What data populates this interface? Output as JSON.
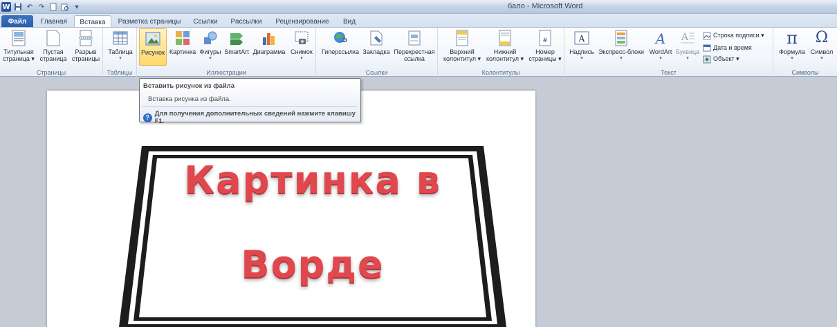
{
  "window": {
    "title": "бало - Microsoft Word"
  },
  "tabs": [
    {
      "label": "Файл"
    },
    {
      "label": "Главная"
    },
    {
      "label": "Вставка"
    },
    {
      "label": "Разметка страницы"
    },
    {
      "label": "Ссылки"
    },
    {
      "label": "Рассылки"
    },
    {
      "label": "Рецензирование"
    },
    {
      "label": "Вид"
    }
  ],
  "ribbon": {
    "groups": {
      "pages": "Страницы",
      "tables": "Таблицы",
      "illustrations": "Иллюстрации",
      "links": "Ссылки",
      "headers": "Колонтитулы",
      "text": "Текст",
      "symbols": "Символы"
    },
    "buttons": {
      "title_page_1": "Титульная",
      "title_page_2": "страница ▾",
      "blank_page_1": "Пустая",
      "blank_page_2": "страница",
      "page_break_1": "Разрыв",
      "page_break_2": "страницы",
      "table": "Таблица",
      "picture": "Рисунок",
      "clipart": "Картинка",
      "shapes": "Фигуры",
      "smartart": "SmartArt",
      "chart": "Диаграмма",
      "screenshot": "Снимок",
      "hyperlink": "Гиперссылка",
      "bookmark": "Закладка",
      "crossref_1": "Перекрестная",
      "crossref_2": "ссылка",
      "header_1": "Верхний",
      "header_2": "колонтитул ▾",
      "footer_1": "Нижний",
      "footer_2": "колонтитул ▾",
      "pagenum_1": "Номер",
      "pagenum_2": "страницы ▾",
      "textbox": "Надпись",
      "quickparts": "Экспресс-блоки",
      "wordart": "WordArt",
      "dropcap": "Буквица",
      "signature": "Строка подписи ▾",
      "datetime": "Дата и время",
      "object": "Объект ▾",
      "equation": "Формула",
      "symbol": "Символ"
    }
  },
  "tooltip": {
    "title": "Вставить рисунок из файла",
    "description": "Вставка рисунка из файла.",
    "help": "Для получения дополнительных сведений нажмите клавишу F1."
  },
  "picture": {
    "line1": "Картинка в",
    "line2": "Ворде"
  },
  "colors": {
    "accent": "#2a5cab",
    "picture_text": "#e0484e",
    "highlight": "#ffd86b"
  }
}
